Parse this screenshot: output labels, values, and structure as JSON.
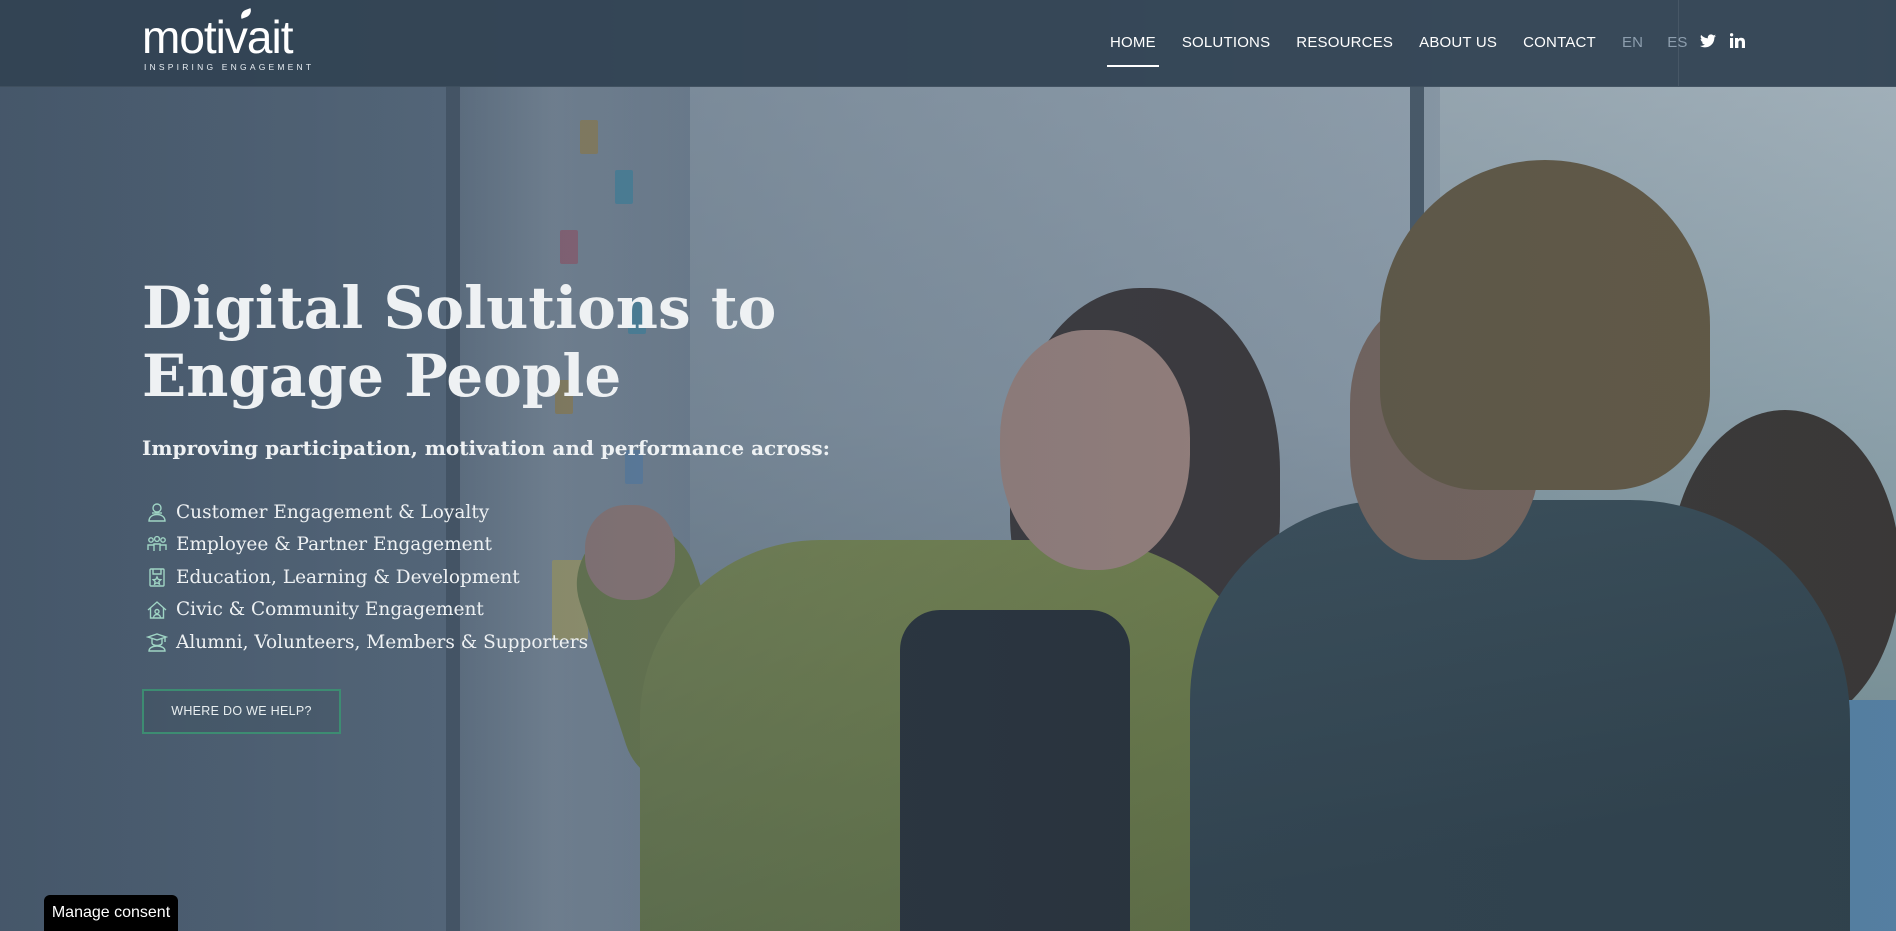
{
  "brand": {
    "name": "motivait",
    "tagline": "INSPIRING ENGAGEMENT"
  },
  "nav": {
    "items": [
      {
        "label": "HOME",
        "active": true
      },
      {
        "label": "SOLUTIONS",
        "active": false
      },
      {
        "label": "RESOURCES",
        "active": false
      },
      {
        "label": "ABOUT US",
        "active": false
      },
      {
        "label": "CONTACT",
        "active": false
      }
    ],
    "languages": [
      "EN",
      "ES"
    ]
  },
  "social": [
    "twitter-icon",
    "linkedin-icon"
  ],
  "hero": {
    "title": "Digital Solutions to Engage People",
    "subtitle": "Improving participation, motivation and performance across:",
    "items": [
      {
        "label": "Customer Engagement & Loyalty",
        "icon": "customer-icon"
      },
      {
        "label": "Employee & Partner Engagement",
        "icon": "team-icon"
      },
      {
        "label": "Education, Learning & Development",
        "icon": "education-icon"
      },
      {
        "label": "Civic & Community Engagement",
        "icon": "community-icon"
      },
      {
        "label": "Alumni, Volunteers, Members & Supporters",
        "icon": "graduate-icon"
      }
    ],
    "cta_label": "WHERE DO WE HELP?"
  },
  "consent": {
    "label": "Manage consent"
  },
  "colors": {
    "header_bg": "#324353",
    "accent": "#3d8c72",
    "text": "#eef1f3"
  }
}
